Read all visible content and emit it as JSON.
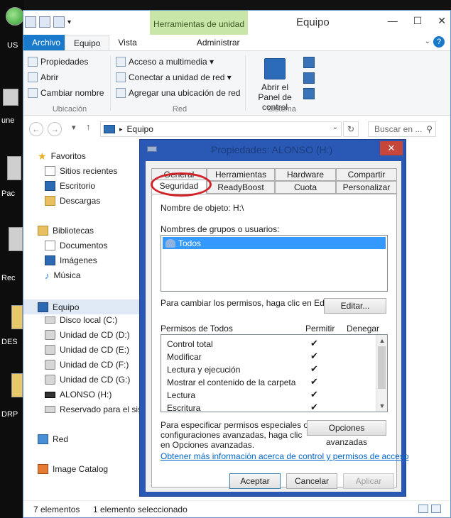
{
  "desktop": {
    "labels": [
      "US",
      "une",
      "Pac",
      "Rec",
      "DES",
      "DRP"
    ]
  },
  "window": {
    "title": "Equipo",
    "context_tab": "Herramientas de unidad",
    "min_glyph": "—",
    "max_glyph": "☐",
    "close_glyph": "✕"
  },
  "ribbon": {
    "tabs": [
      "Archivo",
      "Equipo",
      "Vista",
      "Administrar"
    ],
    "help_glyph": "?",
    "ubicacion": {
      "items": [
        "Propiedades",
        "Abrir",
        "Cambiar nombre"
      ],
      "label": "Ubicación"
    },
    "red": {
      "items": [
        "Acceso a multimedia ▾",
        "Conectar a unidad de red ▾",
        "Agregar una ubicación de red"
      ],
      "label": "Red"
    },
    "sistema": {
      "open_panel": "Abrir el Panel de control",
      "label": "Sistema"
    }
  },
  "address": {
    "path": "Equipo",
    "search_placeholder": "Buscar en ...",
    "back_glyph": "←",
    "forward_glyph": "→",
    "up_glyph": "↑",
    "recent_glyph": "▾",
    "refresh_glyph": "↻",
    "search_glyph": "⚲"
  },
  "navpane": {
    "favoritos": "Favoritos",
    "favoritos_items": [
      "Sitios recientes",
      "Escritorio",
      "Descargas"
    ],
    "bibliotecas": "Bibliotecas",
    "bibliotecas_items": [
      "Documentos",
      "Imágenes",
      "Música"
    ],
    "equipo": "Equipo",
    "equipo_items": [
      "Disco local (C:)",
      "Unidad de CD (D:)",
      "Unidad de CD (E:)",
      "Unidad de CD (F:)",
      "Unidad de CD (G:)",
      "ALONSO (H:)",
      "Reservado para el sist"
    ],
    "red": "Red",
    "image_catalog": "Image Catalog"
  },
  "status": {
    "count": "7 elementos",
    "selected": "1 elemento seleccionado"
  },
  "dialog": {
    "title": "Propiedades: ALONSO (H:)",
    "tabs_row1": [
      "General",
      "Herramientas",
      "Hardware",
      "Compartir"
    ],
    "tabs_row2": [
      "Seguridad",
      "ReadyBoost",
      "Cuota",
      "Personalizar"
    ],
    "object_name_label": "Nombre de objeto:",
    "object_name_value": "H:\\",
    "groups_label": "Nombres de grupos o usuarios:",
    "groups": [
      "Todos"
    ],
    "change_perms_text": "Para cambiar los permisos, haga clic en Editar.",
    "edit_button": "Editar...",
    "perms_header": "Permisos de Todos",
    "allow_header": "Permitir",
    "deny_header": "Denegar",
    "permissions": [
      {
        "name": "Control total",
        "allow": "✔"
      },
      {
        "name": "Modificar",
        "allow": "✔"
      },
      {
        "name": "Lectura y ejecución",
        "allow": "✔"
      },
      {
        "name": "Mostrar el contenido de la carpeta",
        "allow": "✔"
      },
      {
        "name": "Lectura",
        "allow": "✔"
      },
      {
        "name": "Escritura",
        "allow": "✔"
      }
    ],
    "special_text_1": "Para especificar permisos especiales o",
    "special_text_2": "configuraciones avanzadas, haga clic",
    "special_text_3": "en Opciones avanzadas.",
    "advanced_button": "Opciones avanzadas",
    "more_info_link": "Obtener más información acerca de control y permisos de acceso",
    "ok_button": "Aceptar",
    "cancel_button": "Cancelar",
    "apply_button": "Aplicar",
    "close_glyph": "✕",
    "scroll_up_glyph": "▲",
    "scroll_down_glyph": "▼"
  },
  "colors": {
    "accent": "#1979ca",
    "dialog_frame": "#2a59b5",
    "annotation": "#d0242a",
    "context_tab": "#c9e6a9"
  }
}
